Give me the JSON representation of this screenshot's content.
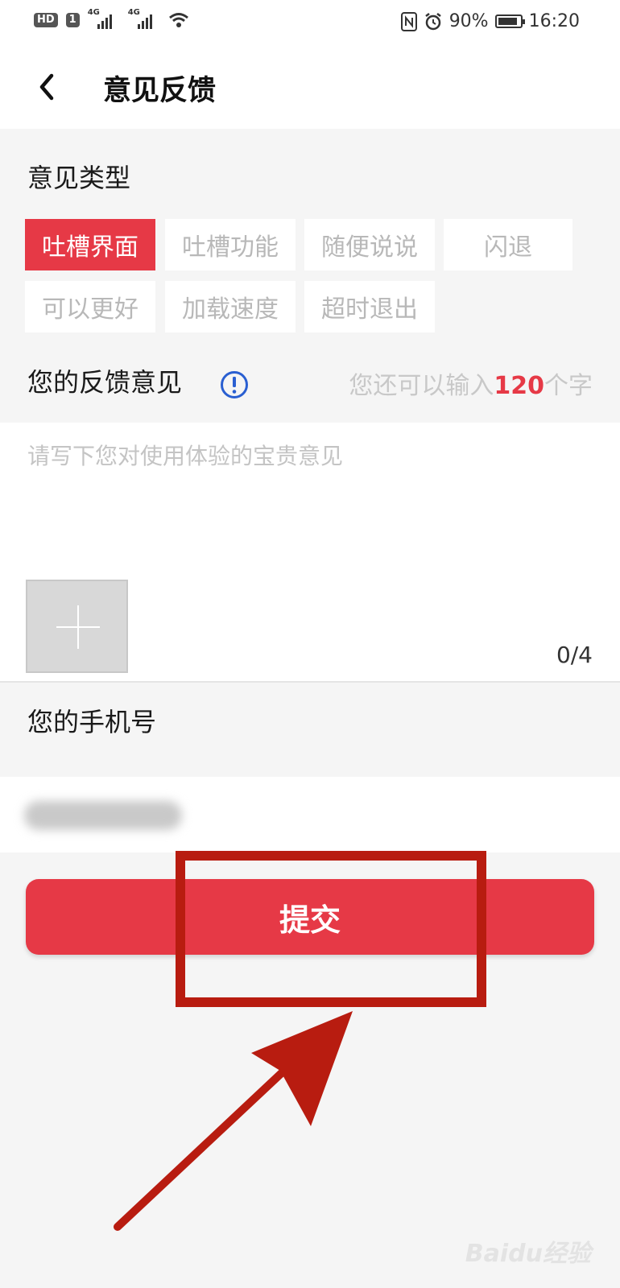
{
  "statusbar": {
    "hd_label": "HD",
    "sim1_label": "1",
    "sig1_label": "4G",
    "sig2_label": "4G",
    "battery_text": "90%",
    "time": "16:20",
    "battery_level": 0.9
  },
  "header": {
    "title": "意见反馈"
  },
  "type_section": {
    "label": "意见类型",
    "chips": [
      "吐槽界面",
      "吐槽功能",
      "随便说说",
      "闪退",
      "可以更好",
      "加载速度",
      "超时退出"
    ],
    "selected": "吐槽界面"
  },
  "feedback": {
    "label": "您的反馈意见",
    "counter_prefix": "您还可以输入",
    "counter_value": "120",
    "counter_suffix": "个字",
    "placeholder": "请写下您对使用体验的宝贵意见",
    "photo_count": "0/4"
  },
  "phone": {
    "label": "您的手机号"
  },
  "submit": {
    "label": "提交"
  },
  "watermark": {
    "text": "Baidu经验"
  },
  "colors": {
    "accent": "#e63946",
    "annotation": "#b81c10",
    "info_icon": "#2a5fd1"
  }
}
